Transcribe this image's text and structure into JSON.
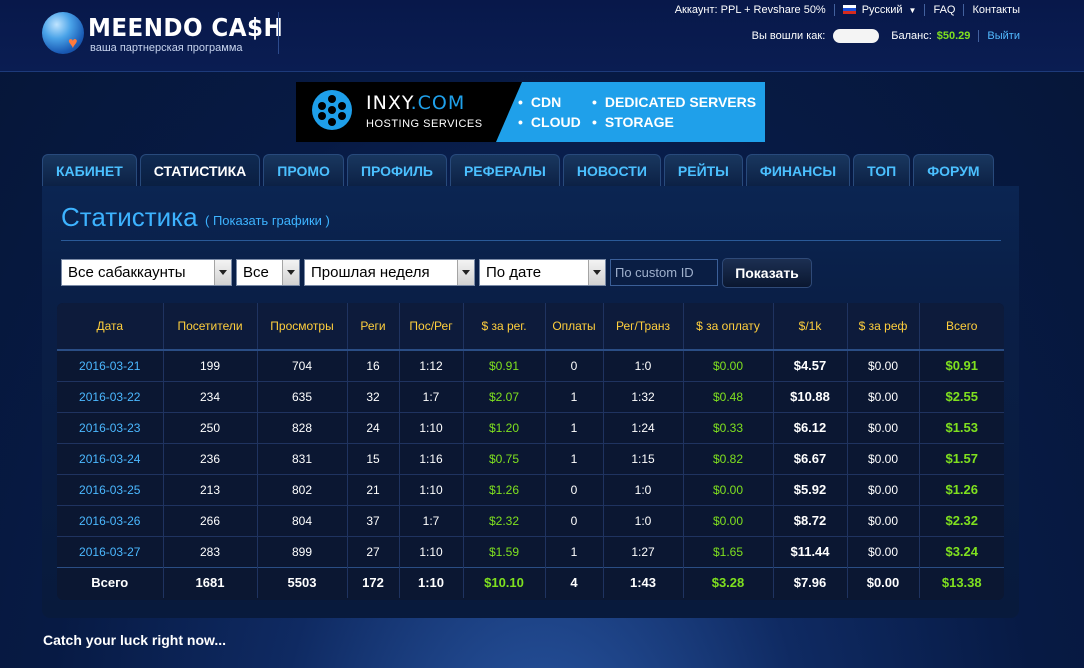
{
  "logo": {
    "title": "MEENDO CA$H",
    "subtitle": "ваша партнерская программа"
  },
  "top": {
    "account": "Аккаунт: PPL + Revshare 50%",
    "language": "Русский",
    "faq": "FAQ",
    "contacts": "Контакты",
    "logged_in_label": "Вы вошли как:",
    "balance_label": "Баланс:",
    "balance_value": "$50.29",
    "logout": "Выйти"
  },
  "banner": {
    "brand": "INXY",
    "brand_suffix": ".COM",
    "tagline": "HOSTING SERVICES",
    "features": [
      "CDN",
      "CLOUD",
      "DEDICATED SERVERS",
      "STORAGE"
    ]
  },
  "tabs": [
    {
      "label": "КАБИНЕТ",
      "active": false
    },
    {
      "label": "СТАТИСТИКА",
      "active": true
    },
    {
      "label": "ПРОМО",
      "active": false
    },
    {
      "label": "ПРОФИЛЬ",
      "active": false
    },
    {
      "label": "РЕФЕРАЛЫ",
      "active": false
    },
    {
      "label": "НОВОСТИ",
      "active": false
    },
    {
      "label": "РЕЙТЫ",
      "active": false
    },
    {
      "label": "ФИНАНСЫ",
      "active": false
    },
    {
      "label": "ТОП",
      "active": false
    },
    {
      "label": "ФОРУМ",
      "active": false
    }
  ],
  "page": {
    "title": "Статистика",
    "show_graphs": "( Показать графики )"
  },
  "filters": {
    "subaccounts": "Все сабаккаунты",
    "all": "Все",
    "period": "Прошлая неделя",
    "group": "По дате",
    "custom_placeholder": "По custom ID",
    "submit": "Показать"
  },
  "table": {
    "headers": [
      "Дата",
      "Посетители",
      "Просмотры",
      "Реги",
      "Пос/Рег",
      "$ за рег.",
      "Оплаты",
      "Рег/Транз",
      "$ за оплату",
      "$/1k",
      "$ за реф",
      "Всего"
    ],
    "rows": [
      [
        "2016-03-21",
        "199",
        "704",
        "16",
        "1:12",
        "$0.91",
        "0",
        "1:0",
        "$0.00",
        "$4.57",
        "$0.00",
        "$0.91"
      ],
      [
        "2016-03-22",
        "234",
        "635",
        "32",
        "1:7",
        "$2.07",
        "1",
        "1:32",
        "$0.48",
        "$10.88",
        "$0.00",
        "$2.55"
      ],
      [
        "2016-03-23",
        "250",
        "828",
        "24",
        "1:10",
        "$1.20",
        "1",
        "1:24",
        "$0.33",
        "$6.12",
        "$0.00",
        "$1.53"
      ],
      [
        "2016-03-24",
        "236",
        "831",
        "15",
        "1:16",
        "$0.75",
        "1",
        "1:15",
        "$0.82",
        "$6.67",
        "$0.00",
        "$1.57"
      ],
      [
        "2016-03-25",
        "213",
        "802",
        "21",
        "1:10",
        "$1.26",
        "0",
        "1:0",
        "$0.00",
        "$5.92",
        "$0.00",
        "$1.26"
      ],
      [
        "2016-03-26",
        "266",
        "804",
        "37",
        "1:7",
        "$2.32",
        "0",
        "1:0",
        "$0.00",
        "$8.72",
        "$0.00",
        "$2.32"
      ],
      [
        "2016-03-27",
        "283",
        "899",
        "27",
        "1:10",
        "$1.59",
        "1",
        "1:27",
        "$1.65",
        "$11.44",
        "$0.00",
        "$3.24"
      ]
    ],
    "total": [
      "Всего",
      "1681",
      "5503",
      "172",
      "1:10",
      "$10.10",
      "4",
      "1:43",
      "$3.28",
      "$7.96",
      "$0.00",
      "$13.38"
    ]
  },
  "footer": "Catch your luck right now..."
}
